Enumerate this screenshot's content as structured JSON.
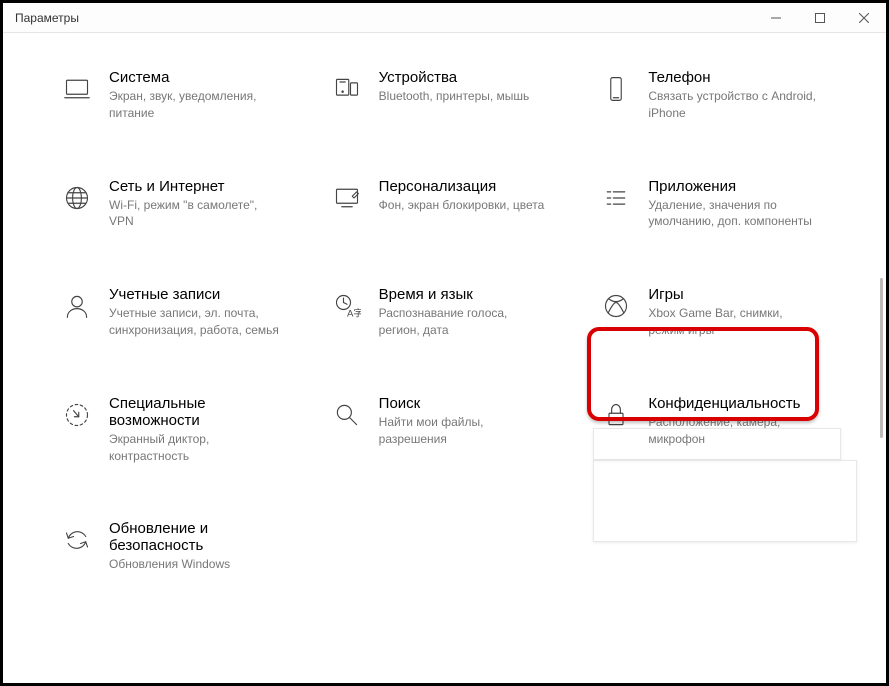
{
  "window": {
    "title": "Параметры"
  },
  "categories": [
    {
      "title": "Система",
      "desc": "Экран, звук, уведомления, питание"
    },
    {
      "title": "Устройства",
      "desc": "Bluetooth, принтеры, мышь"
    },
    {
      "title": "Телефон",
      "desc": "Связать устройство с Android, iPhone"
    },
    {
      "title": "Сеть и Интернет",
      "desc": "Wi-Fi, режим \"в самолете\", VPN"
    },
    {
      "title": "Персонализация",
      "desc": "Фон, экран блокировки, цвета"
    },
    {
      "title": "Приложения",
      "desc": "Удаление, значения по умолчанию, доп. компоненты"
    },
    {
      "title": "Учетные записи",
      "desc": "Учетные записи, эл. почта, синхронизация, работа, семья"
    },
    {
      "title": "Время и язык",
      "desc": "Распознавание голоса, регион, дата"
    },
    {
      "title": "Игры",
      "desc": "Xbox Game Bar, снимки, режим игры"
    },
    {
      "title": "Специальные возможности",
      "desc": "Экранный диктор, контрастность"
    },
    {
      "title": "Поиск",
      "desc": "Найти мои файлы, разрешения"
    },
    {
      "title": "Конфиденциальность",
      "desc": "Расположение, камера, микрофон"
    },
    {
      "title": "Обновление и безопасность",
      "desc": "Обновления Windows"
    }
  ]
}
